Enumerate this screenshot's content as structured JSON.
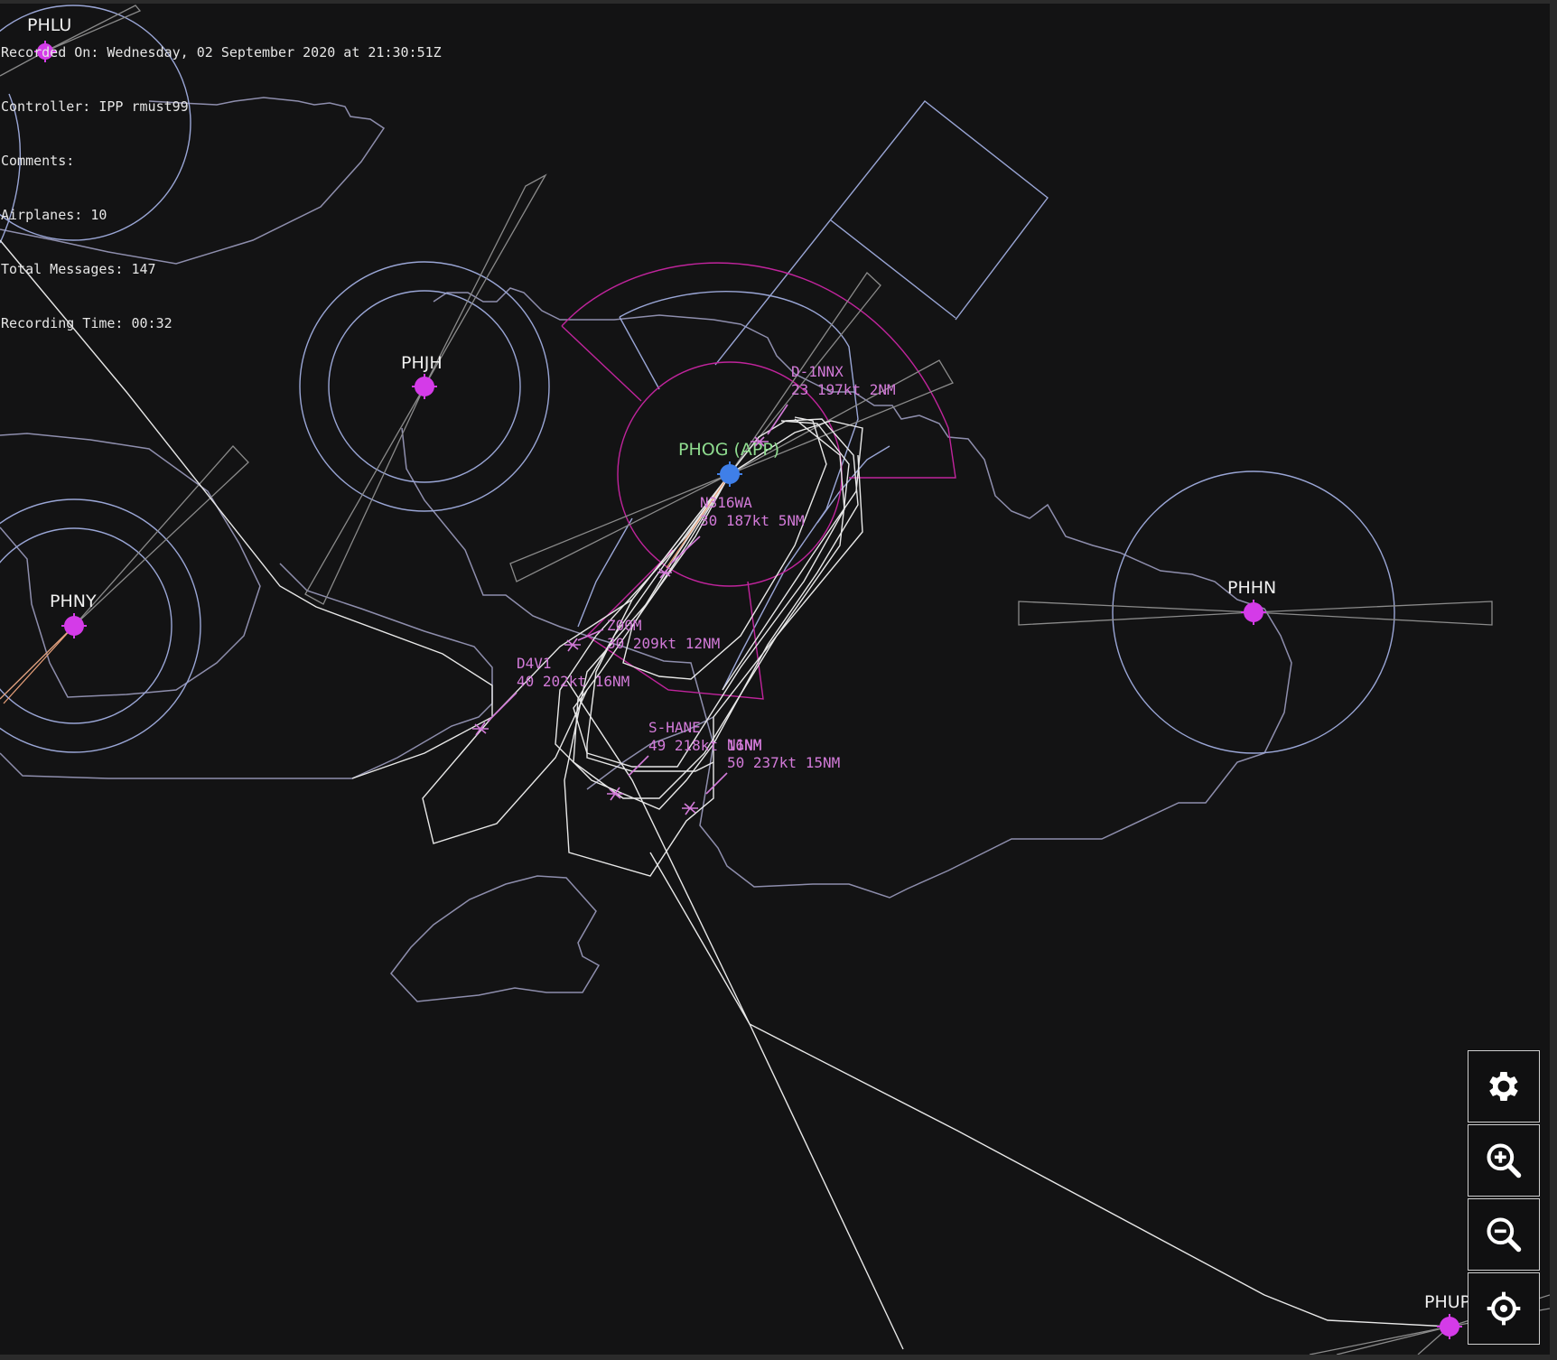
{
  "recording_info": {
    "recorded_on": "Recorded On: Wednesday, 02 September 2020 at 21:30:51Z",
    "controller": "Controller: IPP rmust99",
    "comments": "Comments:",
    "airplanes": "Airplanes: 10",
    "total_messages": "Total Messages: 147",
    "recording_time": "Recording Time: 00:32"
  },
  "airports": [
    {
      "id": "PHLU",
      "label": "PHLU"
    },
    {
      "id": "PHJH",
      "label": "PHJH"
    },
    {
      "id": "PHNY",
      "label": "PHNY"
    },
    {
      "id": "PHOG",
      "label": "PHOG (APP)"
    },
    {
      "id": "PHHN",
      "label": "PHHN"
    },
    {
      "id": "PHUP",
      "label": "PHUP"
    }
  ],
  "aircraft": [
    {
      "callsign": "D-1NNX",
      "data": "23 197kt 2NM"
    },
    {
      "callsign": "N316WA",
      "data": "30 187kt 5NM"
    },
    {
      "callsign": "Z00M",
      "data": "30 209kt 12NM"
    },
    {
      "callsign": "D4V1",
      "data": "40 202kt 16NM"
    },
    {
      "callsign": "S-HANE",
      "data": "49 218kt 16NM"
    },
    {
      "callsign": "N1NM",
      "data": "50 237kt 15NM"
    }
  ],
  "controls": [
    {
      "name": "settings-button",
      "icon": "gear-icon"
    },
    {
      "name": "zoom-in-button",
      "icon": "zoom-in-icon"
    },
    {
      "name": "zoom-out-button",
      "icon": "zoom-out-icon"
    },
    {
      "name": "recenter-button",
      "icon": "crosshair-icon"
    }
  ],
  "colors": {
    "background": "#131314",
    "coastline": "#8e8ead",
    "airspace": "#9aa6d6",
    "app_airspace": "#c0249c",
    "airport": "#d43be8",
    "app_airport": "#3f7fe8",
    "app_label": "#8fdc8f",
    "tag": "#d27ad8",
    "track": "#e8e8e8"
  }
}
